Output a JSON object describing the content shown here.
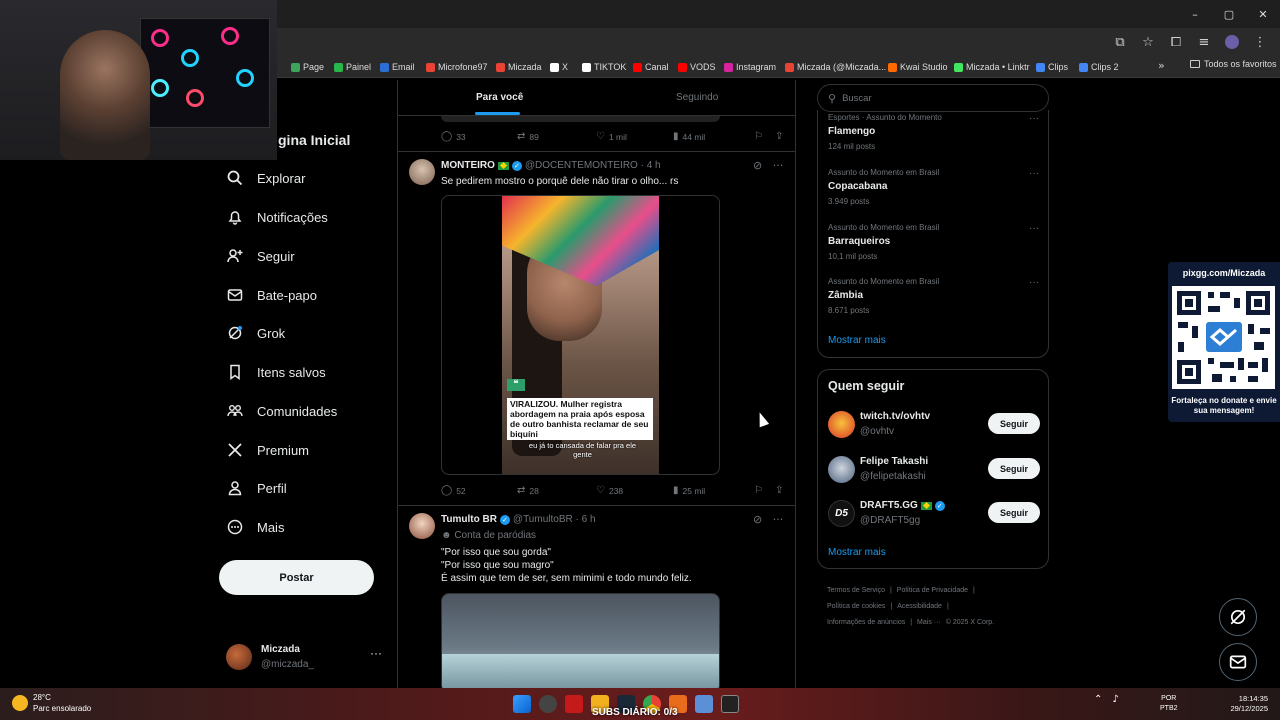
{
  "browser": {
    "window_controls": [
      "–",
      "▢",
      "✕"
    ],
    "bookmarks": [
      {
        "label": "Page",
        "color": "#3ba55c"
      },
      {
        "label": "Painel",
        "color": "#28b84a"
      },
      {
        "label": "Email",
        "color": "#2b6fd6"
      },
      {
        "label": "Microfone97",
        "color": "#ea4335"
      },
      {
        "label": "Miczada",
        "color": "#ea4335"
      },
      {
        "label": "X",
        "color": "#ffffff"
      },
      {
        "label": "TIKTOK",
        "color": "#ffffff"
      },
      {
        "label": "Canal",
        "color": "#ff0000"
      },
      {
        "label": "VODS",
        "color": "#ff0000"
      },
      {
        "label": "Instagram",
        "color": "#d6249f"
      },
      {
        "label": "Miczada (@Miczada...",
        "color": "#ea4335"
      },
      {
        "label": "Kwai Studio",
        "color": "#ff6a00"
      },
      {
        "label": "Miczada • Linktr",
        "color": "#43e660"
      },
      {
        "label": "Clips",
        "color": "#4285f4"
      },
      {
        "label": "Clips 2",
        "color": "#4285f4"
      }
    ],
    "bookmarks_more": "»",
    "all_favorites": "Todos os favoritos"
  },
  "sidebar": {
    "title_partial": "gina Inicial",
    "items": [
      {
        "label": "Explorar",
        "icon": "search-icon"
      },
      {
        "label": "Notificações",
        "icon": "bell-icon"
      },
      {
        "label": "Seguir",
        "icon": "add-person-icon"
      },
      {
        "label": "Bate-papo",
        "icon": "mail-icon"
      },
      {
        "label": "Grok",
        "icon": "grok-icon"
      },
      {
        "label": "Itens salvos",
        "icon": "bookmark-icon"
      },
      {
        "label": "Comunidades",
        "icon": "communities-icon"
      },
      {
        "label": "Premium",
        "icon": "x-logo-icon"
      },
      {
        "label": "Perfil",
        "icon": "person-icon"
      },
      {
        "label": "Mais",
        "icon": "more-circle-icon"
      }
    ],
    "post_button": "Postar",
    "profile": {
      "name": "Miczada",
      "handle": "@miczada_",
      "more": "···"
    }
  },
  "feed": {
    "tabs": [
      {
        "label": "Para você",
        "active": true
      },
      {
        "label": "Seguindo",
        "active": false
      }
    ],
    "prev_actions": {
      "replies": "33",
      "reposts": "89",
      "likes": "1 mil",
      "views": "44 mil"
    },
    "tweets": [
      {
        "name": "MONTEIRO",
        "handle_time": "@DOCENTEMONTEIRO · 4 h",
        "text": "Se pedirem mostro o porquê dele não tirar o olho... rs",
        "media_caption": "VIRALIZOU. Mulher registra abordagem na praia após esposa de outro banhista reclamar de seu biquíni",
        "media_subtitle": "eu já to cansada de falar pra ele gente",
        "actions": {
          "replies": "52",
          "reposts": "28",
          "likes": "238",
          "views": "25 mil"
        }
      },
      {
        "name": "Tumulto BR",
        "handle_time": "@TumultoBR · 6 h",
        "label": "Conta de paródias",
        "lines": [
          "\"Por isso que sou gorda\"",
          "\"Por isso que sou magro\"",
          "É assim que tem de ser, sem mimimi e todo mundo feliz."
        ]
      }
    ]
  },
  "right": {
    "search_placeholder": "Buscar",
    "trends": [
      {
        "category": "Esportes · Assunto do Momento",
        "title": "Flamengo",
        "count": "124 mil posts"
      },
      {
        "category": "Assunto do Momento em Brasil",
        "title": "Copacabana",
        "count": "3.949 posts"
      },
      {
        "category": "Assunto do Momento em Brasil",
        "title": "Barraqueiros",
        "count": "10,1 mil posts"
      },
      {
        "category": "Assunto do Momento em Brasil",
        "title": "Zâmbia",
        "count": "8.671 posts"
      }
    ],
    "trends_show_more": "Mostrar mais",
    "who_to_follow": {
      "title": "Quem seguir",
      "users": [
        {
          "name": "twitch.tv/ovhtv",
          "handle": "@ovhtv",
          "button": "Seguir"
        },
        {
          "name": "Felipe Takashi",
          "handle": "@felipetakashi",
          "button": "Seguir"
        },
        {
          "name": "DRAFT5.GG",
          "handle": "@DRAFT5gg",
          "button": "Seguir"
        }
      ],
      "show_more": "Mostrar mais"
    },
    "footer": [
      "Termos de Serviço",
      "|",
      "Política de Privacidade",
      "|",
      "Política de cookies",
      "|",
      "Acessibilidade",
      "|",
      "Informações de anúncios",
      "|",
      "Mais ···",
      "© 2025 X Corp."
    ]
  },
  "overlay": {
    "pix_title": "pixgg.com/Miczada",
    "pix_footer": "Fortaleça no donate e envie sua mensagem!"
  },
  "taskbar": {
    "temp": "28°C",
    "weather": "Parc ensolarado",
    "subs": "SUBS DIÁRIO: 0/3",
    "lang1": "POR",
    "lang2": "PTB2",
    "time": "18:14:35",
    "date": "29/12/2025"
  }
}
